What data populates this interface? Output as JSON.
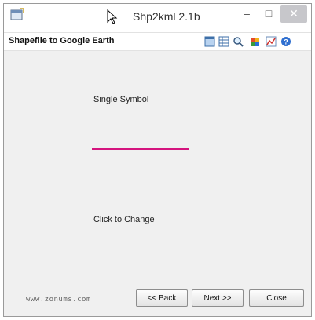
{
  "window": {
    "title": "Shp2kml 2.1b",
    "minimize_glyph": "–",
    "maximize_glyph": "□",
    "close_glyph": "✕"
  },
  "header": {
    "label": "Shapefile to Google Earth",
    "tools": [
      "window-icon",
      "table-icon",
      "magnify-icon",
      "palette-icon",
      "chart-icon",
      "help-icon"
    ]
  },
  "main": {
    "symbol_label": "Single Symbol",
    "symbol_color": "#d4147e",
    "change_label": "Click to Change"
  },
  "footer": {
    "url": "www.zonums.com",
    "back_label": "<< Back",
    "next_label": "Next >>",
    "close_label": "Close"
  }
}
